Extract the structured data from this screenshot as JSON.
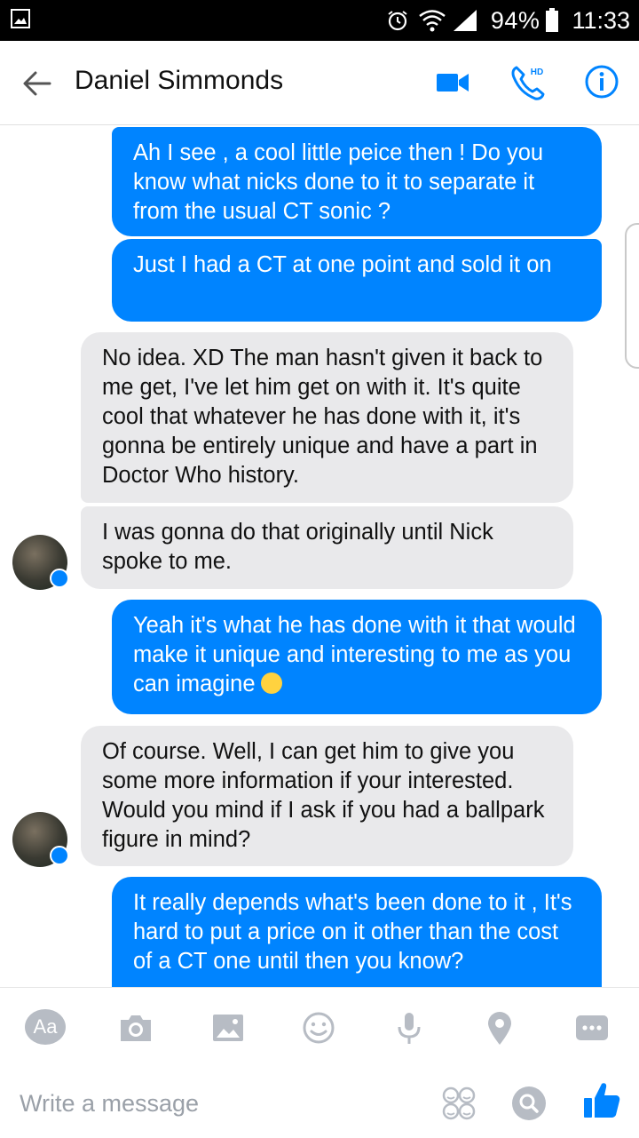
{
  "status_bar": {
    "battery_percent": "94%",
    "time": "11:33",
    "icons": [
      "gallery-icon",
      "alarm-icon",
      "wifi-icon",
      "signal-icon",
      "battery-icon"
    ]
  },
  "header": {
    "contact_name": "Daniel Simmonds",
    "icons": [
      "back-arrow-icon",
      "video-call-icon",
      "phone-hd-icon",
      "info-icon"
    ],
    "accent_color": "#0084ff"
  },
  "messages": [
    {
      "sender": "me",
      "text": "Ah I see , a cool little peice then ! Do you know what nicks done to it to separate it from the usual CT sonic ?"
    },
    {
      "sender": "me",
      "text": "Just I had a CT at one point and sold it on"
    },
    {
      "sender": "them",
      "text": "No idea. XD The man hasn't given it back to me get, I've let him get on with it. It's quite cool that whatever he has done with it, it's gonna be entirely unique and have a part in Doctor Who history."
    },
    {
      "sender": "them",
      "text": "I was gonna do that originally until Nick spoke to me."
    },
    {
      "sender": "me",
      "text": "Yeah it's what he has done with it that would make it unique and interesting to me as you can imagine",
      "emoji": "smile-emoji"
    },
    {
      "sender": "them",
      "text": "Of course. Well, I can get him to give you some more information if your interested. Would you mind if I ask if you had a ballpark figure in mind?"
    },
    {
      "sender": "me",
      "text": "It really depends what's been done to it , It's hard to put a price on it other than the cost of a CT one until then you know?"
    }
  ],
  "composer": {
    "aa_label": "Aa",
    "placeholder": "Write a message",
    "toolbar_icons": [
      "camera-icon",
      "image-icon",
      "emoji-icon",
      "microphone-icon",
      "location-icon",
      "more-icon"
    ],
    "action_icons": [
      "stickers-icon",
      "search-icon",
      "thumbs-up-icon"
    ]
  },
  "colors": {
    "outgoing_bubble": "#0084ff",
    "incoming_bubble": "#e9e9eb",
    "icon_gray": "#b7bcc4"
  }
}
